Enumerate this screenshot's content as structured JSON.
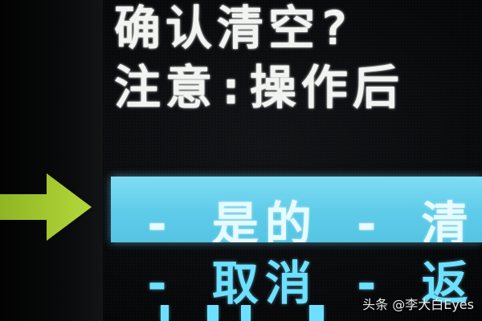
{
  "dialog": {
    "title": "确认清空?",
    "note": "注意:操作后"
  },
  "options": [
    {
      "label": "- 是的 - 清",
      "selected": true
    },
    {
      "label": "- 取消 - 返",
      "selected": false
    }
  ],
  "pointer": {
    "icon": "arrow-right-icon",
    "color": "#a9cf2f"
  },
  "colors": {
    "highlight": "#5ecbe9",
    "option_text": "#6ee0ff",
    "title_text": "#f2f4f2"
  },
  "watermark": "头条 @李大白Eyes"
}
